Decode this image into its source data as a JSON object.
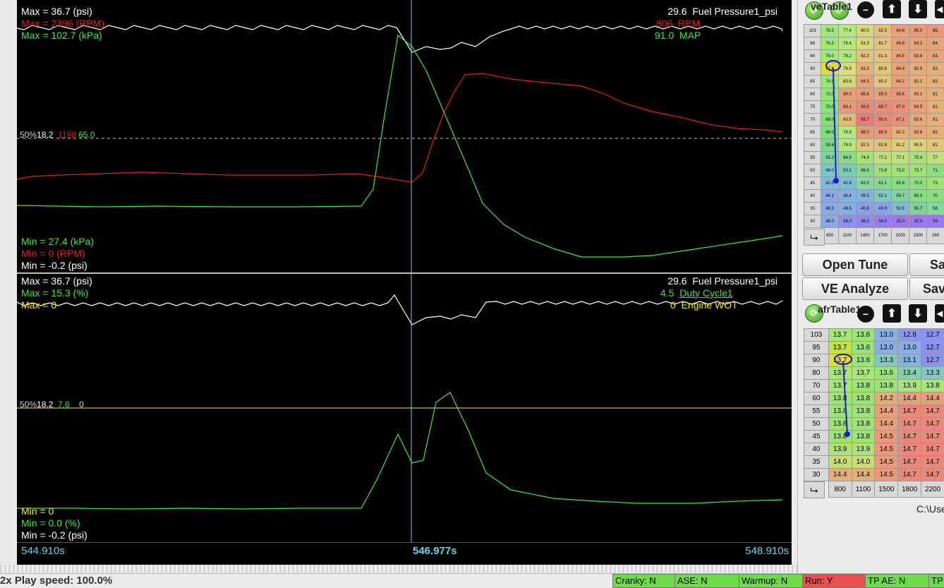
{
  "top_plot": {
    "left_labels": [
      {
        "text": "Max = 36.7 (psi)",
        "color": "#ffffff"
      },
      {
        "text": "Max = 2396 (RPM)",
        "color": "#e02020"
      },
      {
        "text": "Max = 102.7 (kPa)",
        "color": "#3ee83e"
      }
    ],
    "right_labels": [
      {
        "value": "29.6",
        "name": "Fuel Pressure1_psi",
        "color": "#ffffff"
      },
      {
        "value": "806",
        "name": "RPM",
        "color": "#e02020"
      },
      {
        "value": "91.0",
        "name": "MAP",
        "color": "#3ee83e"
      }
    ],
    "mid_label": {
      "pct": "50%",
      "v1": "18.2",
      "v2": "1198",
      "v3": "65.0"
    },
    "min_labels": [
      {
        "text": "Min = 27.4 (kPa)",
        "color": "#3ee83e"
      },
      {
        "text": "Min = 0 (RPM)",
        "color": "#e02020"
      },
      {
        "text": "Min = -0.2 (psi)",
        "color": "#ffffff"
      }
    ]
  },
  "bottom_plot": {
    "left_labels": [
      {
        "text": "Max = 36.7 (psi)",
        "color": "#ffffff"
      },
      {
        "text": "Max = 15.3 (%)",
        "color": "#3ee83e"
      },
      {
        "text": "Max = 0",
        "color": "#f0f000"
      }
    ],
    "right_labels": [
      {
        "value": "29.6",
        "name": "Fuel Pressure1_psi",
        "color": "#ffffff"
      },
      {
        "value": "4.5",
        "name": "Duty Cycle1",
        "color": "#3ee83e"
      },
      {
        "value": "0",
        "name": "Engine WOT",
        "color": "#f0f000"
      }
    ],
    "mid_label": {
      "pct": "50%",
      "v1": "18.2",
      "v2": "7.6",
      "v3": "0"
    },
    "min_labels": [
      {
        "text": "Min = 0",
        "color": "#f0f000"
      },
      {
        "text": "Min = 0.0 (%)",
        "color": "#3ee83e"
      },
      {
        "text": "Min = -0.2 (psi)",
        "color": "#ffffff"
      }
    ]
  },
  "timeline": {
    "start": "544.910s",
    "cursor": "546.977s",
    "end": "548.910s"
  },
  "ve_table": {
    "title": "veTable1",
    "rows": [
      "103",
      "98",
      "94",
      "90",
      "85",
      "80",
      "75",
      "70",
      "65",
      "60",
      "55",
      "50",
      "45",
      "40",
      "35",
      "30"
    ],
    "cols": [
      "800",
      "1100",
      "1400",
      "1700",
      "2000",
      "2300",
      "260"
    ],
    "values": [
      [
        "76.5",
        "77.4",
        "80.0",
        "82.3",
        "84.8",
        "85.0",
        "85."
      ],
      [
        "76.2",
        "78.4",
        "81.3",
        "81.7",
        "84.8",
        "84.2",
        "84."
      ],
      [
        "76.0",
        "78.2",
        "82.3",
        "81.3",
        "84.5",
        "83.6",
        "83."
      ],
      [
        "77.4",
        "79.9",
        "83.3",
        "80.8",
        "84.4",
        "82.9",
        "82."
      ],
      [
        "74.5",
        "80.9",
        "84.5",
        "80.2",
        "84.2",
        "82.1",
        "82."
      ],
      [
        "72.0",
        "88.0",
        "85.8",
        "85.0",
        "85.6",
        "83.1",
        "81."
      ],
      [
        "70.0",
        "88.1",
        "90.5",
        "89.7",
        "87.0",
        "84.5",
        "81."
      ],
      [
        "68.0",
        "80.9",
        "93.7",
        "90.0",
        "87.1",
        "83.6",
        "81."
      ],
      [
        "66.0",
        "78.9",
        "88.0",
        "85.9",
        "82.2",
        "82.6",
        "82."
      ],
      [
        "59.6",
        "78.9",
        "82.3",
        "81.8",
        "81.2",
        "80.5",
        "81."
      ],
      [
        "55.2",
        "66.9",
        "74.9",
        "77.2",
        "77.1",
        "75.4",
        "77."
      ],
      [
        "48.0",
        "50.1",
        "66.6",
        "73.8",
        "73.0",
        "73.7",
        "71."
      ],
      [
        "42.0",
        "42.9",
        "63.5",
        "61.1",
        "65.8",
        "70.0",
        "73."
      ],
      [
        "44.1",
        "46.4",
        "45.5",
        "52.1",
        "59.7",
        "65.0",
        "70."
      ],
      [
        "48.3",
        "46.5",
        "40.9",
        "43.9",
        "50.5",
        "56.7",
        "58."
      ],
      [
        "48.0",
        "38.0",
        "36.0",
        "34.0",
        "32.0",
        "32.0",
        "33."
      ]
    ],
    "colors": [
      [
        "#a4e77a",
        "#b4ea7c",
        "#d8d87a",
        "#e3c07a",
        "#e8a17a",
        "#e89b7a",
        "#e6987a"
      ],
      [
        "#a4e77a",
        "#b6e87c",
        "#d8d87a",
        "#e3c27a",
        "#e8a17a",
        "#e6a47a",
        "#e3a67a"
      ],
      [
        "#a4e77a",
        "#b4e87c",
        "#e3c27a",
        "#e3c27a",
        "#e8a17a",
        "#e6a67a",
        "#e3a67a"
      ],
      [
        "#dede3a",
        "#d8e07a",
        "#e6b07a",
        "#e2c47a",
        "#e8a27a",
        "#e6ad7a",
        "#e3b07a"
      ],
      [
        "#9ae67a",
        "#d0da7a",
        "#e8a17a",
        "#e2c67a",
        "#e8a27a",
        "#e6ae7a",
        "#e3b07a"
      ],
      [
        "#92e47a",
        "#e8a07a",
        "#e89a7a",
        "#e8a07a",
        "#e89a7a",
        "#e6aa7a",
        "#e3b07a"
      ],
      [
        "#8ae27a",
        "#e89b7a",
        "#e88a7a",
        "#e88c7a",
        "#e8927a",
        "#e8a07a",
        "#e3b07a"
      ],
      [
        "#86e07a",
        "#e0bb7a",
        "#e87a7a",
        "#e88a7a",
        "#e8927a",
        "#e6aa7a",
        "#e3b07a"
      ],
      [
        "#80de80",
        "#b6e87c",
        "#e89a7a",
        "#e89a7a",
        "#e6ae7a",
        "#e6aa7a",
        "#e3b07a"
      ],
      [
        "#7ed88a",
        "#b6e87c",
        "#e3c27a",
        "#e0c27a",
        "#e0ca7a",
        "#d8d27a",
        "#e0c87a"
      ],
      [
        "#7cd4a0",
        "#88dc88",
        "#a8e07a",
        "#c0e07a",
        "#c0e07a",
        "#a8e07a",
        "#c0e07a"
      ],
      [
        "#7cc6c6",
        "#80cab8",
        "#88d890",
        "#a0e07a",
        "#9ee07a",
        "#a0e07a",
        "#92dc80"
      ],
      [
        "#82b8dc",
        "#80bcd4",
        "#84d8a0",
        "#8ad890",
        "#88dc88",
        "#90dc80",
        "#9ee07a"
      ],
      [
        "#8aa8e6",
        "#84b0e2",
        "#84b4dc",
        "#80c8c0",
        "#80d29e",
        "#88dc88",
        "#90dc80"
      ],
      [
        "#8aa8e6",
        "#84b0e2",
        "#8c9ce6",
        "#8aa2e6",
        "#80bcd4",
        "#82d09e",
        "#84d89a"
      ],
      [
        "#8aa8e6",
        "#8c90e8",
        "#9088ea",
        "#9480ea",
        "#9c78ea",
        "#9c78ea",
        "#9878ea"
      ]
    ]
  },
  "afr_table": {
    "title": "afrTable1",
    "rows": [
      "103",
      "95",
      "90",
      "80",
      "70",
      "60",
      "55",
      "50",
      "45",
      "40",
      "35",
      "30"
    ],
    "cols": [
      "800",
      "1100",
      "1500",
      "1800",
      "2200"
    ],
    "values": [
      [
        "13.7",
        "13.6",
        "13.0",
        "12.8",
        "12.7"
      ],
      [
        "13.7",
        "13.6",
        "13.0",
        "13.0",
        "12.7"
      ],
      [
        "13.7",
        "13.6",
        "13.3",
        "13.1",
        "12.7"
      ],
      [
        "13.7",
        "13.7",
        "13.6",
        "13.4",
        "13.3"
      ],
      [
        "13.7",
        "13.8",
        "13.8",
        "13.9",
        "13.8"
      ],
      [
        "13.8",
        "13.8",
        "14.2",
        "14.4",
        "14.4"
      ],
      [
        "13.8",
        "13.8",
        "14.4",
        "14.7",
        "14.7"
      ],
      [
        "13.8",
        "13.8",
        "14.4",
        "14.7",
        "14.7"
      ],
      [
        "13.8",
        "13.8",
        "14.5",
        "14.7",
        "14.7"
      ],
      [
        "13.9",
        "13.9",
        "14.5",
        "14.7",
        "14.7"
      ],
      [
        "14.0",
        "14.0",
        "14.5",
        "14.7",
        "14.7"
      ],
      [
        "14.4",
        "14.4",
        "14.5",
        "14.7",
        "14.7"
      ]
    ],
    "colors": [
      [
        "#a8e47a",
        "#9ae47a",
        "#8ab0e6",
        "#8a9aea",
        "#8a92ea"
      ],
      [
        "#c2e24a",
        "#9ae47a",
        "#8ab0e6",
        "#8ab0e6",
        "#8a92ea"
      ],
      [
        "#dede3a",
        "#9ae47a",
        "#86c8c0",
        "#84b4dc",
        "#8a92ea"
      ],
      [
        "#a8e47a",
        "#a8e47a",
        "#9ae47a",
        "#86d0b0",
        "#86c8c0"
      ],
      [
        "#a8e47a",
        "#9ee27a",
        "#9ee27a",
        "#a8e47a",
        "#a8e47a"
      ],
      [
        "#9ee27a",
        "#9ee27a",
        "#e0b07a",
        "#e8a07a",
        "#e8a07a"
      ],
      [
        "#9ee27a",
        "#9ee27a",
        "#e8a07a",
        "#e88a7a",
        "#e88a7a"
      ],
      [
        "#9ee27a",
        "#9ee27a",
        "#e8a07a",
        "#e88a7a",
        "#e88a7a"
      ],
      [
        "#9ee27a",
        "#9ee27a",
        "#e89a7a",
        "#e88a7a",
        "#e88a7a"
      ],
      [
        "#b0e07a",
        "#b0e07a",
        "#e89a7a",
        "#e88a7a",
        "#e88a7a"
      ],
      [
        "#c8dc7a",
        "#c8dc7a",
        "#e89a7a",
        "#e88a7a",
        "#e88a7a"
      ],
      [
        "#e0b07a",
        "#e0b07a",
        "#e89a7a",
        "#e88a7a",
        "#e88a7a"
      ]
    ]
  },
  "buttons": {
    "open_tune": "Open Tune",
    "save": "Sa",
    "ve_analyze": "VE Analyze",
    "save_as": "Sav"
  },
  "path_text": "C:\\Use",
  "toolbar_icons": {
    "green": "refresh-icon",
    "dark": "minus-icon",
    "up": "arrow-up-icon",
    "down": "arrow-down-icon"
  },
  "corner_icon": "⮡",
  "status": {
    "play_text": "2x   Play speed: 100.0%",
    "indicators": [
      {
        "label": "Cranky: N",
        "color": "#6edc4a"
      },
      {
        "label": "ASE: N",
        "color": "#6edc4a"
      },
      {
        "label": "Warmup: N",
        "color": "#6edc4a"
      },
      {
        "label": "Run: Y",
        "color": "#e85050"
      },
      {
        "label": "TP AE: N",
        "color": "#6edc4a"
      },
      {
        "label": "TP",
        "color": "#6edc4a"
      }
    ]
  },
  "trace_colors": {
    "white": "#ffffff",
    "red": "#e02020",
    "green": "#3ee83e",
    "yellow": "#e8e85a",
    "cursor": "#5fd7e8"
  }
}
